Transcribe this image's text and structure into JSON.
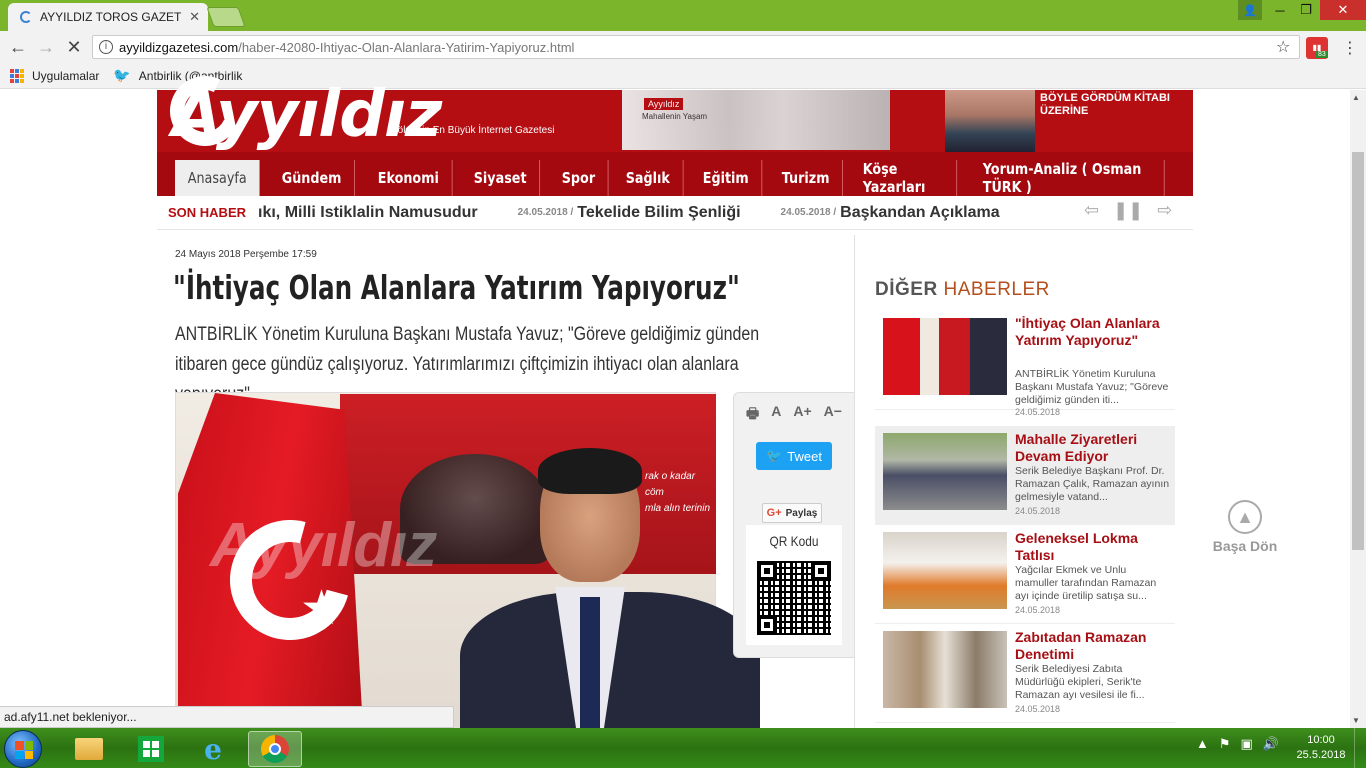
{
  "browser": {
    "tab_title": "AYYILDIZ TOROS GAZETE",
    "url_domain": "ayyildizgazetesi.com",
    "url_path": "/haber-42080-Ihtiyac-Olan-Alanlara-Yatirim-Yapiyoruz.html",
    "bookmarks": [
      "Uygulamalar",
      "Antbirlik (@antbirlik"
    ],
    "extension_badge": "83",
    "status_text": "ad.afy11.net bekleniyor..."
  },
  "header": {
    "logo_text": "Ayyıldız",
    "logo_sub": "Bölgenin En Büyük İnternet Gazetesi",
    "promo_text": "BÖYLE GÖRDÜM KİTABI ÜZERİNE",
    "papers_name": "Ayyıldız",
    "papers_text": "Mahallenin Yaşam"
  },
  "nav": [
    "Anasayfa",
    "Gündem",
    "Ekonomi",
    "Siyaset",
    "Spor",
    "Sağlık",
    "Eğitim",
    "Turizm",
    "Köşe Yazarları",
    "Yorum-Analiz ( Osman TÜRK )"
  ],
  "ticker": {
    "label": "SON HABER",
    "items": [
      {
        "date": "",
        "text": "ıkı, Milli Istiklalin Namusudur"
      },
      {
        "date": "24.05.2018 /",
        "text": "Tekelide Bilim Şenliği"
      },
      {
        "date": "24.05.2018 /",
        "text": "Başkandan Açıklama"
      }
    ]
  },
  "article": {
    "date": "24 Mayıs 2018 Perşembe  17:59",
    "title": "\"İhtiyaç Olan Alanlara Yatırım Yapıyoruz\"",
    "lead": "ANTBİRLİK Yönetim Kuruluna Başkanı Mustafa Yavuz; \"Göreve geldiğimiz günden itibaren gece gündüz çalışıyoruz. Yatırımlarımızı çiftçimizin ihtiyacı olan alanlara yapıyoruz\"",
    "image_quote_1": "rak o kadar cöm",
    "image_quote_2": "mla alın terinin",
    "image_watermark": "Ayyıldız"
  },
  "share": {
    "tools": [
      "A",
      "A+",
      "A−"
    ],
    "tweet_label": "Tweet",
    "gplus_label": "Paylaş",
    "qr_label": "QR Kodu"
  },
  "sidebar": {
    "title_1": "DİĞER",
    "title_2": "HABERLER",
    "items": [
      {
        "title": "\"İhtiyaç Olan Alanlara Yatırım Yapıyoruz\"",
        "desc": "ANTBİRLİK Yönetim Kuruluna Başkanı Mustafa Yavuz; \"Göreve geldiğimiz günden iti...",
        "date": "24.05.2018"
      },
      {
        "title": "Mahalle Ziyaretleri Devam Ediyor",
        "desc": "Serik Belediye Başkanı Prof. Dr. Ramazan Çalık, Ramazan ayının gelmesiyle vatand...",
        "date": "24.05.2018"
      },
      {
        "title": "Geleneksel Lokma Tatlısı",
        "desc": "Yağcılar Ekmek ve Unlu mamuller tarafından Ramazan ayı içinde üretilip satışa su...",
        "date": "24.05.2018"
      },
      {
        "title": "Zabıtadan Ramazan Denetimi",
        "desc": "Serik Belediyesi Zabıta Müdürlüğü ekipleri, Serik'te Ramazan ayı vesilesi ile fi...",
        "date": "24.05.2018"
      }
    ]
  },
  "back_to_top": "Başa Dön",
  "taskbar": {
    "time": "10:00",
    "date": "25.5.2018"
  }
}
